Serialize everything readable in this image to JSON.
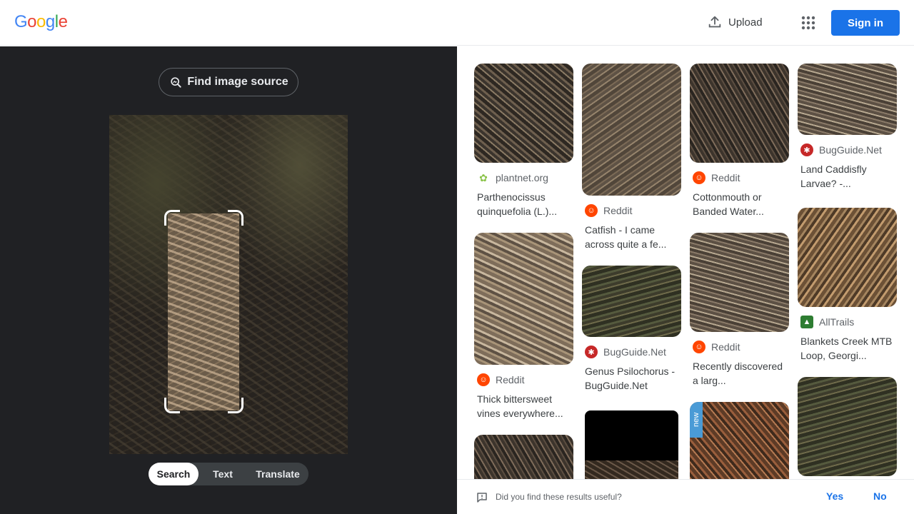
{
  "header": {
    "logo_letters": [
      "G",
      "o",
      "o",
      "g",
      "l",
      "e"
    ],
    "logo_colors": [
      "#4285f4",
      "#ea4335",
      "#fbbc05",
      "#4285f4",
      "#34a853",
      "#ea4335"
    ],
    "upload_label": "Upload",
    "upload_icon": "upload-icon",
    "apps_icon": "apps-grid-icon",
    "signin_label": "Sign in"
  },
  "lens": {
    "find_source_label": "Find image source",
    "find_source_icon": "image-search-icon",
    "modes": [
      "Search",
      "Text",
      "Translate"
    ],
    "active_mode": "Search"
  },
  "results": [
    {
      "source": "plantnet.org",
      "favicon": "plant-icon",
      "favicon_color": "#8bc34a",
      "title": "Parthenocissus quinquefolia (L.)..."
    },
    {
      "source": "Reddit",
      "favicon": "reddit-icon",
      "favicon_color": "#ff4500",
      "title": "Catfish - I came across quite a fe..."
    },
    {
      "source": "Reddit",
      "favicon": "reddit-icon",
      "favicon_color": "#ff4500",
      "title": "Cottonmouth or Banded Water..."
    },
    {
      "source": "BugGuide.Net",
      "favicon": "bug-icon",
      "favicon_color": "#c62828",
      "title": "Land Caddisfly Larvae? -..."
    },
    {
      "source": "Reddit",
      "favicon": "reddit-icon",
      "favicon_color": "#ff4500",
      "title": "Thick bittersweet vines everywhere..."
    },
    {
      "source": "BugGuide.Net",
      "favicon": "bug-icon",
      "favicon_color": "#c62828",
      "title": "Genus Psilochorus - BugGuide.Net"
    },
    {
      "source": "Reddit",
      "favicon": "reddit-icon",
      "favicon_color": "#ff4500",
      "title": "Recently discovered a larg..."
    },
    {
      "source": "AllTrails",
      "favicon": "alltrails-icon",
      "favicon_color": "#2e7d32",
      "title": "Blankets Creek MTB Loop, Georgi..."
    }
  ],
  "new_tag": "new",
  "feedback": {
    "question": "Did you find these results useful?",
    "yes_label": "Yes",
    "no_label": "No"
  }
}
